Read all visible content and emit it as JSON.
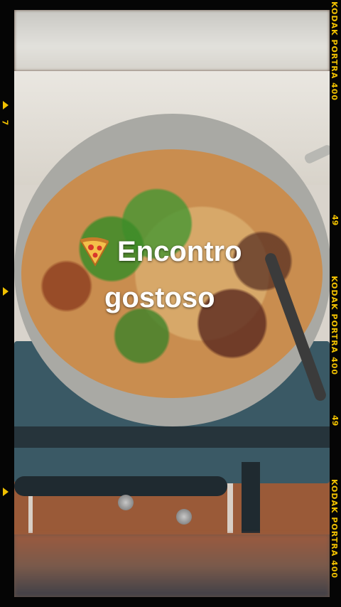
{
  "caption": {
    "line1": "Encontro",
    "line2": "gostoso",
    "emoji_icon": "pizza-icon"
  },
  "film_strip": {
    "right_labels": [
      "KODAK PORTRA 400",
      "49",
      "KODAK PORTRA 400",
      "49",
      "KODAK PORTRA 400"
    ],
    "left_number": "7",
    "accent_color": "#f0c000"
  }
}
